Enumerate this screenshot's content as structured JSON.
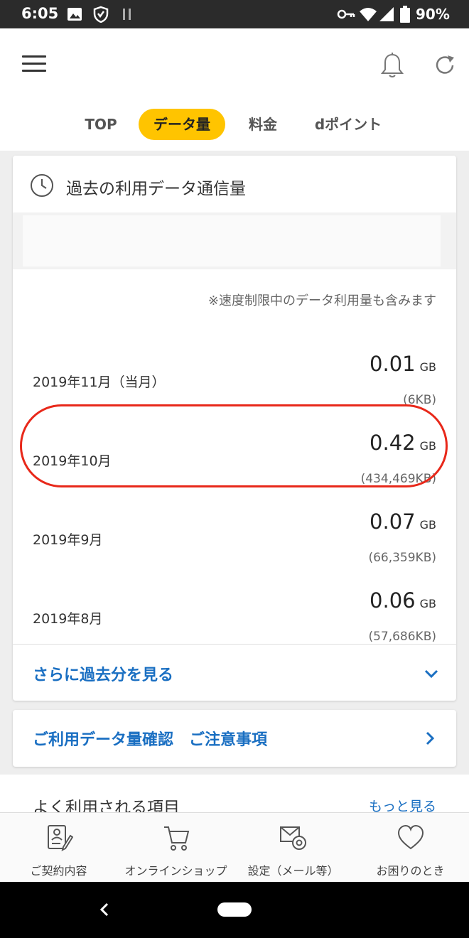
{
  "status_bar": {
    "time": "6:05",
    "battery": "90%"
  },
  "tabs": [
    {
      "label": "TOP",
      "active": false
    },
    {
      "label": "データ量",
      "active": true
    },
    {
      "label": "料金",
      "active": false
    },
    {
      "label": "dポイント",
      "active": false
    }
  ],
  "history": {
    "title": "過去の利用データ通信量",
    "note": "※速度制限中のデータ利用量も含みます",
    "unit": "GB",
    "rows": [
      {
        "month": "2019年11月（当月）",
        "value": "0.01",
        "kb": "(6KB)"
      },
      {
        "month": "2019年10月",
        "value": "0.42",
        "kb": "(434,469KB)"
      },
      {
        "month": "2019年9月",
        "value": "0.07",
        "kb": "(66,359KB)"
      },
      {
        "month": "2019年8月",
        "value": "0.06",
        "kb": "(57,686KB)"
      }
    ],
    "more_label": "さらに過去分を見る"
  },
  "notice": {
    "label": "ご利用データ量確認　ご注意事項"
  },
  "frequent": {
    "title": "よく利用される項目",
    "more": "もっと見る"
  },
  "bottom_nav": [
    {
      "label": "ご契約内容",
      "icon": "contract-icon"
    },
    {
      "label": "オンラインショップ",
      "icon": "cart-icon"
    },
    {
      "label": "設定（メール等）",
      "icon": "mail-settings-icon"
    },
    {
      "label": "お困りのとき",
      "icon": "heart-icon"
    }
  ],
  "colors": {
    "accent": "#ffc400",
    "link": "#1a6fc2",
    "highlight": "#e8281a"
  }
}
